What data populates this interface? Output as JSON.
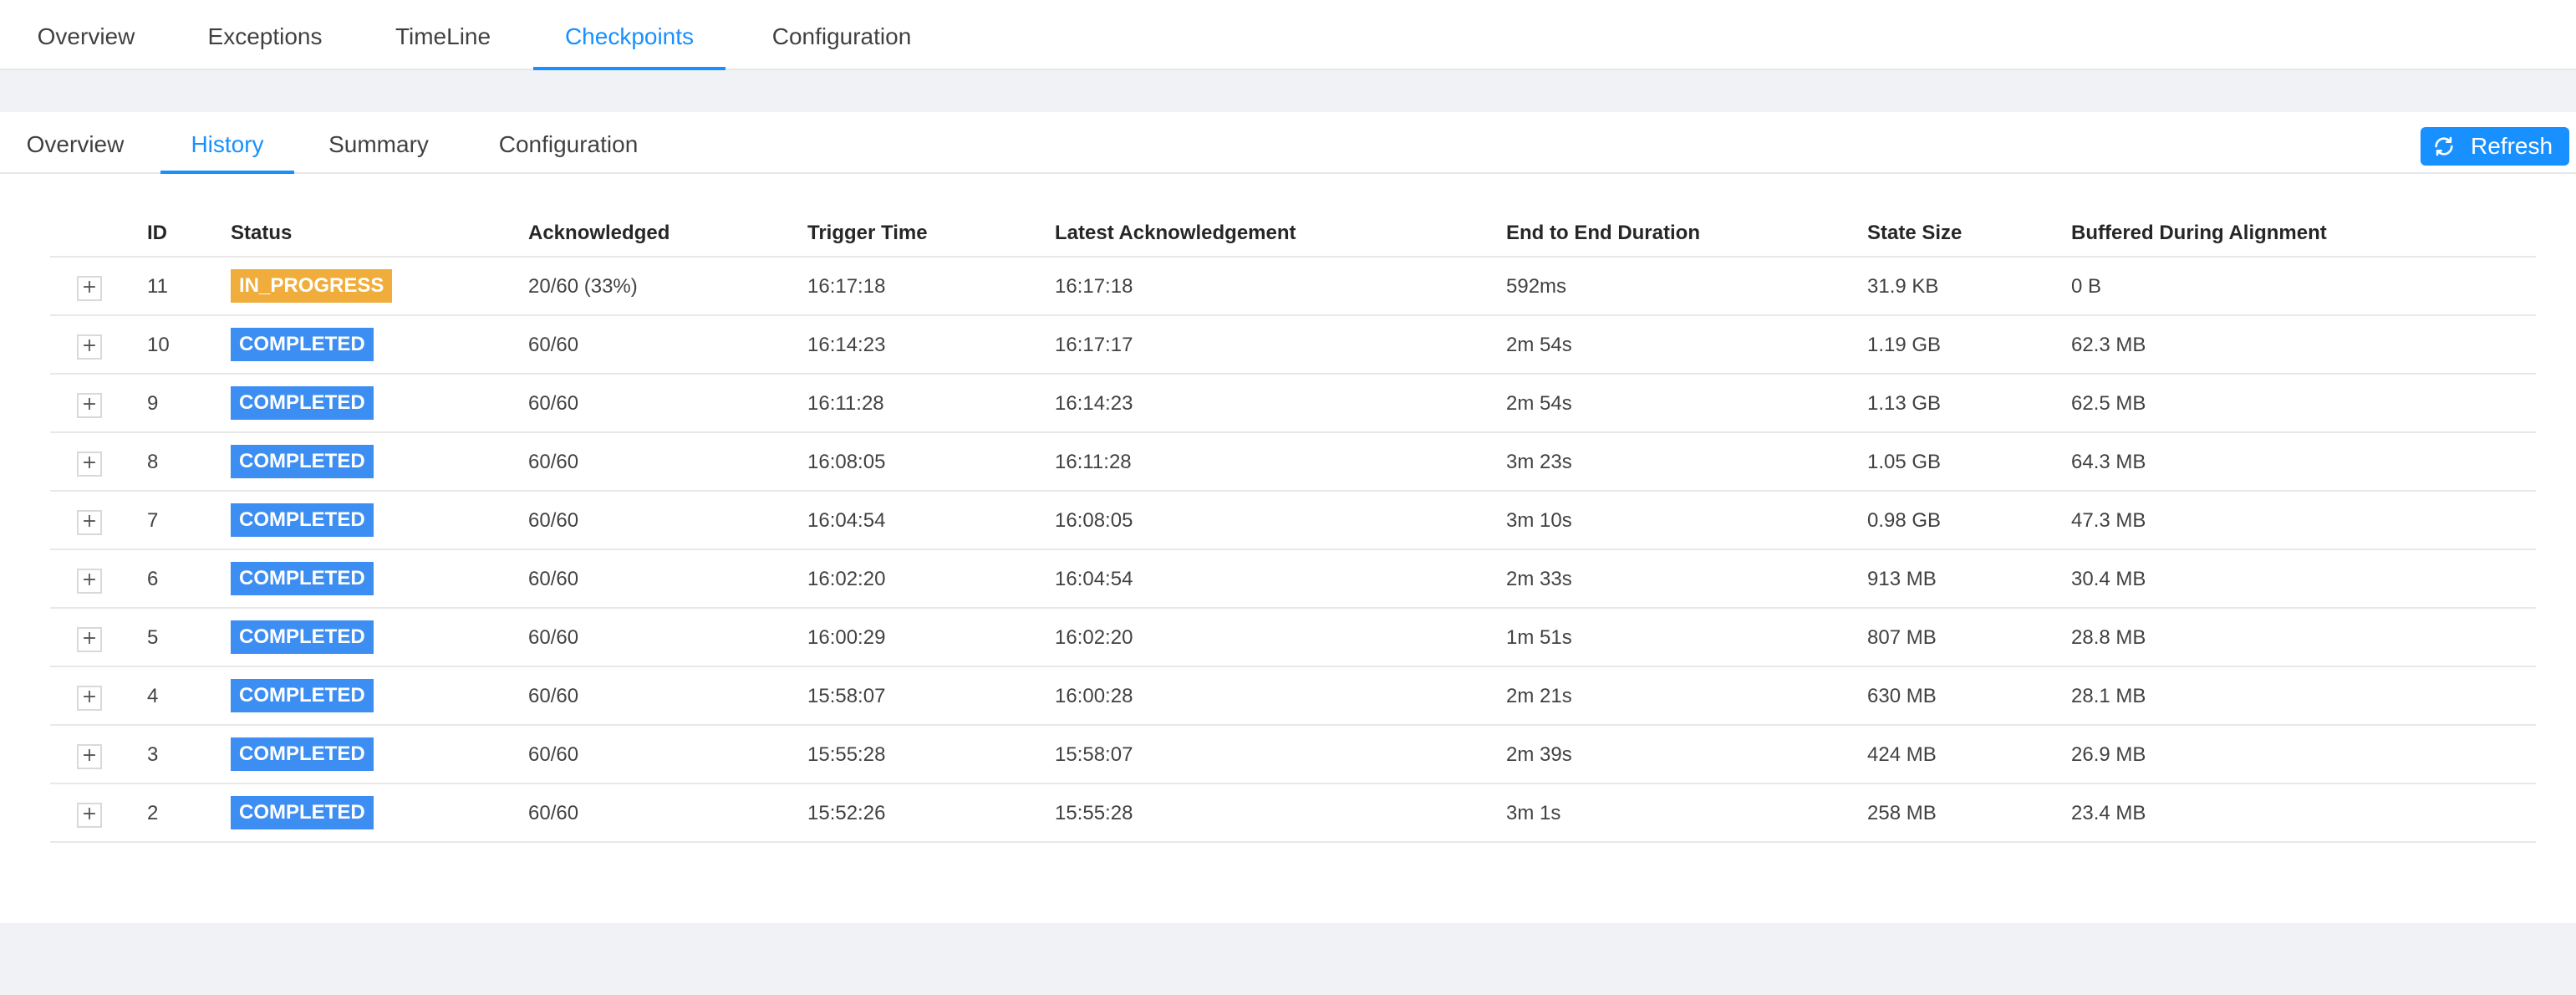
{
  "top_tabs": [
    {
      "label": "Overview",
      "active": false
    },
    {
      "label": "Exceptions",
      "active": false
    },
    {
      "label": "TimeLine",
      "active": false
    },
    {
      "label": "Checkpoints",
      "active": true
    },
    {
      "label": "Configuration",
      "active": false
    }
  ],
  "sub_tabs": [
    {
      "label": "Overview",
      "active": false
    },
    {
      "label": "History",
      "active": true
    },
    {
      "label": "Summary",
      "active": false
    },
    {
      "label": "Configuration",
      "active": false
    }
  ],
  "refresh_button": {
    "label": "Refresh",
    "icon": "refresh-icon"
  },
  "colors": {
    "accent": "#1890ff",
    "completed": "#3d8ef2",
    "in_progress": "#f0ad3c"
  },
  "table": {
    "columns": [
      "ID",
      "Status",
      "Acknowledged",
      "Trigger Time",
      "Latest Acknowledgement",
      "End to End Duration",
      "State Size",
      "Buffered During Alignment"
    ],
    "expand_symbol": "+",
    "rows": [
      {
        "id": "11",
        "status": "IN_PROGRESS",
        "acknowledged": "20/60 (33%)",
        "trigger_time": "16:17:18",
        "latest_ack": "16:17:18",
        "duration": "592ms",
        "state_size": "31.9 KB",
        "buffered": "0 B"
      },
      {
        "id": "10",
        "status": "COMPLETED",
        "acknowledged": "60/60",
        "trigger_time": "16:14:23",
        "latest_ack": "16:17:17",
        "duration": "2m 54s",
        "state_size": "1.19 GB",
        "buffered": "62.3 MB"
      },
      {
        "id": "9",
        "status": "COMPLETED",
        "acknowledged": "60/60",
        "trigger_time": "16:11:28",
        "latest_ack": "16:14:23",
        "duration": "2m 54s",
        "state_size": "1.13 GB",
        "buffered": "62.5 MB"
      },
      {
        "id": "8",
        "status": "COMPLETED",
        "acknowledged": "60/60",
        "trigger_time": "16:08:05",
        "latest_ack": "16:11:28",
        "duration": "3m 23s",
        "state_size": "1.05 GB",
        "buffered": "64.3 MB"
      },
      {
        "id": "7",
        "status": "COMPLETED",
        "acknowledged": "60/60",
        "trigger_time": "16:04:54",
        "latest_ack": "16:08:05",
        "duration": "3m 10s",
        "state_size": "0.98 GB",
        "buffered": "47.3 MB"
      },
      {
        "id": "6",
        "status": "COMPLETED",
        "acknowledged": "60/60",
        "trigger_time": "16:02:20",
        "latest_ack": "16:04:54",
        "duration": "2m 33s",
        "state_size": "913 MB",
        "buffered": "30.4 MB"
      },
      {
        "id": "5",
        "status": "COMPLETED",
        "acknowledged": "60/60",
        "trigger_time": "16:00:29",
        "latest_ack": "16:02:20",
        "duration": "1m 51s",
        "state_size": "807 MB",
        "buffered": "28.8 MB"
      },
      {
        "id": "4",
        "status": "COMPLETED",
        "acknowledged": "60/60",
        "trigger_time": "15:58:07",
        "latest_ack": "16:00:28",
        "duration": "2m 21s",
        "state_size": "630 MB",
        "buffered": "28.1 MB"
      },
      {
        "id": "3",
        "status": "COMPLETED",
        "acknowledged": "60/60",
        "trigger_time": "15:55:28",
        "latest_ack": "15:58:07",
        "duration": "2m 39s",
        "state_size": "424 MB",
        "buffered": "26.9 MB"
      },
      {
        "id": "2",
        "status": "COMPLETED",
        "acknowledged": "60/60",
        "trigger_time": "15:52:26",
        "latest_ack": "15:55:28",
        "duration": "3m 1s",
        "state_size": "258 MB",
        "buffered": "23.4 MB"
      }
    ]
  }
}
